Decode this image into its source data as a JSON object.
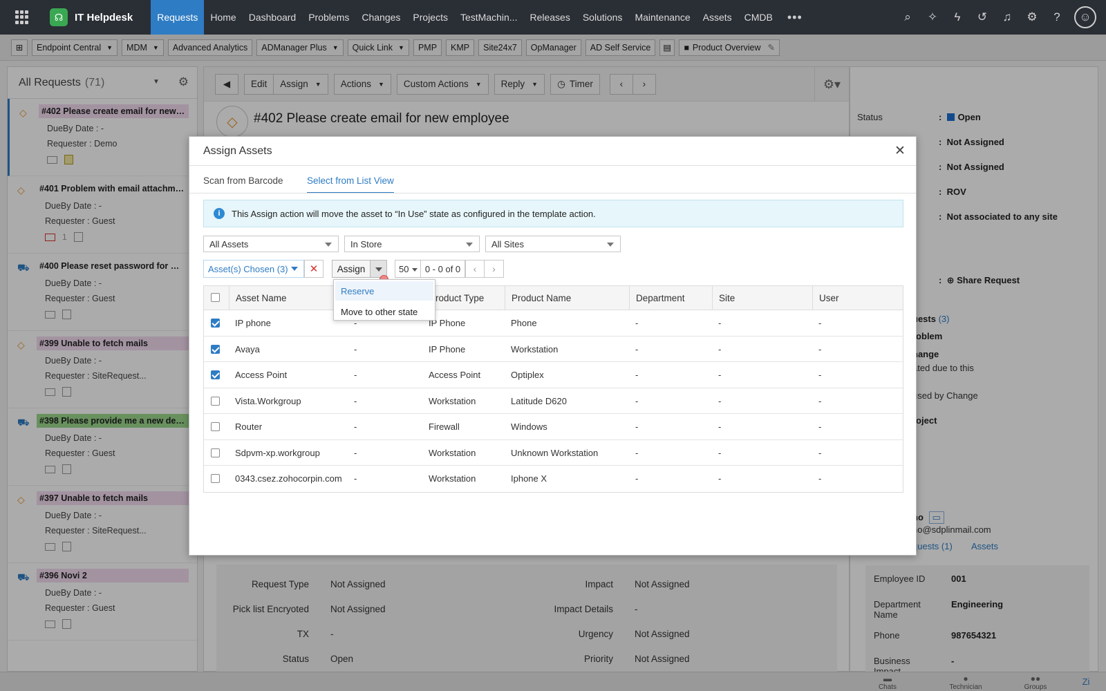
{
  "topbar": {
    "app_title": "IT Helpdesk",
    "nav": [
      "Requests",
      "Home",
      "Dashboard",
      "Problems",
      "Changes",
      "Projects",
      "TestMachin...",
      "Releases",
      "Solutions",
      "Maintenance",
      "Assets",
      "CMDB"
    ],
    "active_nav": "Requests",
    "more": "•••",
    "icons": [
      "search-icon",
      "magic-icon",
      "lightning-icon",
      "history-icon",
      "bell-icon",
      "gear-icon",
      "help-icon",
      "user-avatar-icon"
    ]
  },
  "quicklinks": [
    {
      "label": "Endpoint Central",
      "dropdown": true
    },
    {
      "label": "MDM",
      "dropdown": true
    },
    {
      "label": "Advanced Analytics",
      "dropdown": false
    },
    {
      "label": "ADManager Plus",
      "dropdown": true
    },
    {
      "label": "Quick Link",
      "dropdown": true
    },
    {
      "label": "PMP",
      "dropdown": false
    },
    {
      "label": "KMP",
      "dropdown": false
    },
    {
      "label": "Site24x7",
      "dropdown": false
    },
    {
      "label": "OpManager",
      "dropdown": false
    },
    {
      "label": "AD Self Service",
      "dropdown": false
    },
    {
      "label": "Product Overview",
      "dropdown": false
    }
  ],
  "sidebar": {
    "title": "All Requests",
    "count": "(71)",
    "duey_label": "DueBy Date :",
    "requester_label": "Requester :",
    "requests": [
      {
        "title": "#402 Please create email for new e...",
        "dueby": "-",
        "requester": "Demo",
        "type": "incident",
        "tag": "pink",
        "selected": true,
        "note": true
      },
      {
        "title": "#401 Problem with email attachme...",
        "dueby": "-",
        "requester": "Guest",
        "type": "incident",
        "tag": "none",
        "mail_red": true,
        "count": "1"
      },
      {
        "title": "#400 Please reset password for my...",
        "dueby": "-",
        "requester": "Guest",
        "type": "service",
        "tag": "none"
      },
      {
        "title": "#399 Unable to fetch mails",
        "dueby": "-",
        "requester": "SiteRequest...",
        "type": "incident",
        "tag": "pink"
      },
      {
        "title": "#398 Please provide me a new des...",
        "dueby": "-",
        "requester": "Guest",
        "type": "service",
        "tag": "green"
      },
      {
        "title": "#397 Unable to fetch mails",
        "dueby": "-",
        "requester": "SiteRequest...",
        "type": "incident",
        "tag": "pink"
      },
      {
        "title": "#396 Novi 2",
        "dueby": "-",
        "requester": "Guest",
        "type": "service",
        "tag": "pink"
      }
    ]
  },
  "main": {
    "toolbar": [
      "Edit",
      "Assign",
      "Actions",
      "Custom Actions",
      "Reply",
      "Timer"
    ],
    "request_title": "#402  Please create email for new employee",
    "props": {
      "request_type_label": "Request Type",
      "request_type": "Not Assigned",
      "picklist_label": "Pick list Encryoted",
      "picklist": "Not Assigned",
      "tx_label": "TX",
      "tx": "-",
      "status_label": "Status",
      "status": "Open",
      "impact_label": "Impact",
      "impact": "Not Assigned",
      "impact_details_label": "Impact Details",
      "impact_details": "-",
      "urgency_label": "Urgency",
      "urgency": "Not Assigned",
      "priority_label": "Priority",
      "priority": "Not Assigned"
    }
  },
  "right_panel": {
    "status_label": "Status",
    "status": "Open",
    "values": [
      "Not Assigned",
      "Not Assigned",
      "ROV",
      "Not associated to any site"
    ],
    "share": "Share Request",
    "link_frag": "s",
    "requests_frag": "uests",
    "requests_count": "(3)",
    "problem_frag": "roblem",
    "change_frag": "hange",
    "created_frag": "ated due to this",
    "caused_frag": "used by Change",
    "project_frag": "roject",
    "user_frag": "no",
    "email_frag": "no@sdplinmail.com",
    "ureq_frag": "quests (1)",
    "assets_link": "Assets",
    "emp": {
      "id_label": "Employee ID",
      "id": "001",
      "dept_label": "Department Name",
      "dept": "Engineering",
      "phone_label": "Phone",
      "phone": "987654321",
      "bi_label": "Business Impact",
      "bi": "-"
    }
  },
  "footer": [
    "Chats",
    "Technician",
    "Groups"
  ],
  "modal": {
    "title": "Assign Assets",
    "tabs": [
      "Scan from Barcode",
      "Select from List View"
    ],
    "active_tab": 1,
    "info": "This Assign action will move the asset to “In Use” state as configured in the template action.",
    "filters": [
      "All Assets",
      "In Store",
      "All Sites"
    ],
    "chosen": "Asset(s) Chosen (3)",
    "assign_label": "Assign",
    "per_page": "50",
    "range": "0 - 0 of 0",
    "menu": [
      "Reserve",
      "Move to other state"
    ],
    "columns": [
      "Asset Name",
      "",
      "Product Type",
      "Product Name",
      "Department",
      "Site",
      "User"
    ],
    "rows": [
      {
        "checked": true,
        "name": "IP phone",
        "col2": "-",
        "ptype": "IP Phone",
        "pname": "Phone",
        "dept": "-",
        "site": "-",
        "user": "-"
      },
      {
        "checked": true,
        "name": "Avaya",
        "col2": "-",
        "ptype": "IP Phone",
        "pname": "Workstation",
        "dept": "-",
        "site": "-",
        "user": "-"
      },
      {
        "checked": true,
        "name": "Access Point",
        "col2": "-",
        "ptype": "Access Point",
        "pname": "Optiplex",
        "dept": "-",
        "site": "-",
        "user": "-"
      },
      {
        "checked": false,
        "name": "Vista.Workgroup",
        "col2": "-",
        "ptype": "Workstation",
        "pname": "Latitude D620",
        "dept": "-",
        "site": "-",
        "user": "-"
      },
      {
        "checked": false,
        "name": "Router",
        "col2": "-",
        "ptype": "Firewall",
        "pname": "Windows",
        "dept": "-",
        "site": "-",
        "user": "-"
      },
      {
        "checked": false,
        "name": "Sdpvm-xp.workgroup",
        "col2": "-",
        "ptype": "Workstation",
        "pname": "Unknown Workstation",
        "dept": "-",
        "site": "-",
        "user": "-"
      },
      {
        "checked": false,
        "name": "0343.csez.zohocorpin.com",
        "col2": "-",
        "ptype": "Workstation",
        "pname": "Iphone X",
        "dept": "-",
        "site": "-",
        "user": "-"
      }
    ]
  },
  "colors": {
    "accent": "#2e7cc4",
    "topbar": "#2a2e35",
    "status_open": "#1f6fd1",
    "clear": "#d9312f"
  }
}
